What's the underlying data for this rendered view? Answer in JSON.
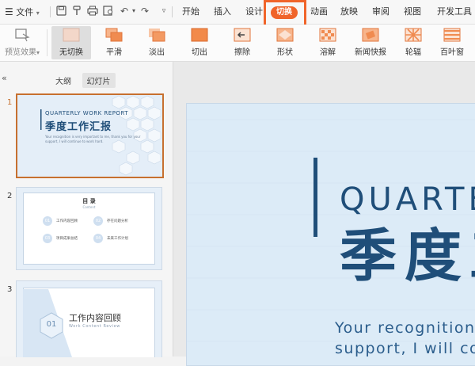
{
  "tabbar": {
    "menu_label": "文件",
    "tabs": [
      "开始",
      "插入",
      "设计",
      "切换",
      "动画",
      "放映",
      "审阅",
      "视图",
      "开发工具"
    ],
    "active_tab": "切换"
  },
  "ribbon": {
    "preview_label": "预览效果",
    "transitions": [
      {
        "label": "无切换",
        "selected": true
      },
      {
        "label": "平滑"
      },
      {
        "label": "淡出"
      },
      {
        "label": "切出"
      },
      {
        "label": "擦除"
      },
      {
        "label": "形状"
      },
      {
        "label": "溶解"
      },
      {
        "label": "新闻快报"
      },
      {
        "label": "轮辐"
      },
      {
        "label": "百叶窗"
      }
    ]
  },
  "panel": {
    "collapse_icon": "«",
    "view_tabs": [
      "大纲",
      "幻灯片"
    ],
    "active_view": "幻灯片",
    "slides": [
      {
        "num": "1",
        "title_en": "QUARTERLY WORK REPORT",
        "title_cn": "季度工作汇报",
        "sub1": "Your recognition is very important to me, thank you for your",
        "sub2": "support, I will continue to work hard."
      },
      {
        "num": "2",
        "title_cn": "目 录",
        "title_en": "Content",
        "items": [
          "01",
          "工作内容回顾",
          "02",
          "存在问题分析",
          "03",
          "项目成果总结",
          "04",
          "未来工作计划"
        ]
      },
      {
        "num": "3",
        "title_cn": "工作内容回顾",
        "title_en": "Work Content Review",
        "badge": "01"
      }
    ]
  },
  "slide": {
    "title_en": "QUARTERLY WORK REPORT",
    "title_cn": "季度工作汇报",
    "sub1": "Your recognition is very important to me, thank you for your",
    "sub2": "support, I will continue to work hard."
  },
  "colors": {
    "accent": "#f0642a",
    "title_blue": "#1f4e79",
    "slide_bg": "#dcebf7"
  }
}
